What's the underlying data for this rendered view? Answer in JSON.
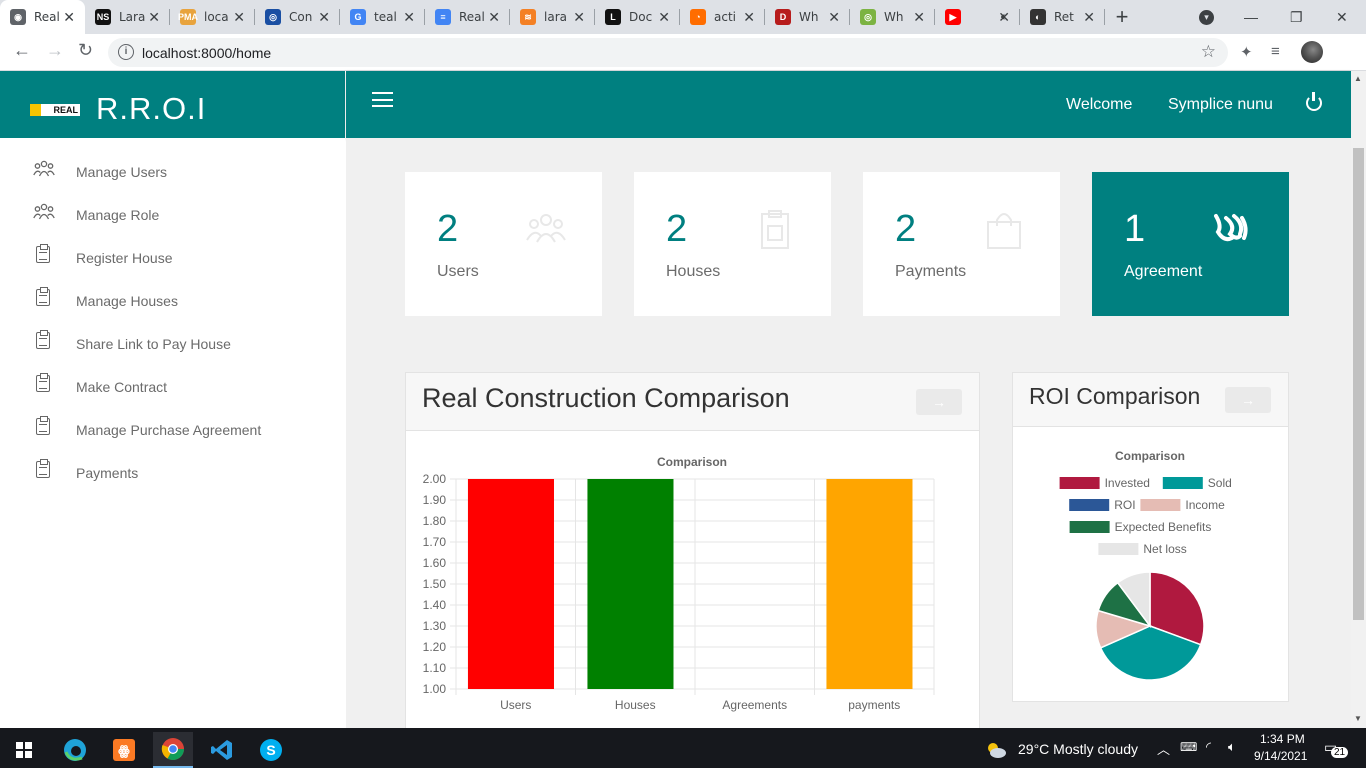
{
  "browser": {
    "tabs": [
      {
        "title": "Real",
        "color": "#5f6368",
        "glyph": "◉",
        "active": true
      },
      {
        "title": "Lara",
        "color": "#111111",
        "glyph": "NS"
      },
      {
        "title": "loca",
        "color": "#e8a33d",
        "glyph": "PMA"
      },
      {
        "title": "Con",
        "color": "#1a4fa3",
        "glyph": "◎"
      },
      {
        "title": "teal",
        "color": "#4285f4",
        "glyph": "G"
      },
      {
        "title": "Real",
        "color": "#4285f4",
        "glyph": "≡"
      },
      {
        "title": "lara",
        "color": "#f48024",
        "glyph": "≋"
      },
      {
        "title": "Doc",
        "color": "#111111",
        "glyph": "L"
      },
      {
        "title": "acti",
        "color": "#ff6d00",
        "glyph": "◔"
      },
      {
        "title": "Wh",
        "color": "#b71c1c",
        "glyph": "D"
      },
      {
        "title": "Wh",
        "color": "#7cb342",
        "glyph": "◎"
      },
      {
        "title": "",
        "color": "#ff0000",
        "glyph": "▶"
      },
      {
        "title": "Ret",
        "color": "#333333",
        "glyph": "◐"
      }
    ],
    "url": "localhost:8000/home"
  },
  "app": {
    "brand": "R.R.O.I",
    "logo_text": "REAL",
    "welcome": "Welcome",
    "user_name": "Symplice nunu",
    "accent": "#008080"
  },
  "sidebar": {
    "items": [
      {
        "label": "Manage Users",
        "icon": "users-icon"
      },
      {
        "label": "Manage Role",
        "icon": "users-icon"
      },
      {
        "label": "Register House",
        "icon": "clipboard-icon"
      },
      {
        "label": "Manage Houses",
        "icon": "clipboard-icon"
      },
      {
        "label": "Share Link to Pay House",
        "icon": "clipboard-icon"
      },
      {
        "label": "Make Contract",
        "icon": "clipboard-icon"
      },
      {
        "label": "Manage Purchase Agreement",
        "icon": "clipboard-icon"
      },
      {
        "label": "Payments",
        "icon": "clipboard-icon"
      }
    ]
  },
  "stats": [
    {
      "value": "2",
      "label": "Users",
      "icon": "users-icon"
    },
    {
      "value": "2",
      "label": "Houses",
      "icon": "clipboard-icon"
    },
    {
      "value": "2",
      "label": "Payments",
      "icon": "shopping-bag-icon"
    },
    {
      "value": "1",
      "label": "Agreement",
      "icon": "handshake-icon"
    }
  ],
  "panels": {
    "construction": {
      "title": "Real Construction Comparison",
      "button": "→"
    },
    "roi": {
      "title": "ROI Comparison",
      "button": "→"
    }
  },
  "chart_data": [
    {
      "type": "bar",
      "title": "Comparison",
      "categories": [
        "Users",
        "Houses",
        "Agreements",
        "payments"
      ],
      "values": [
        2,
        2,
        1,
        2
      ],
      "colors": [
        "#ff0000",
        "#008000",
        "#ffffff",
        "#ffa500"
      ],
      "ylim": [
        1.0,
        2.0
      ],
      "yticks": [
        "2.00",
        "1.90",
        "1.80",
        "1.70",
        "1.60",
        "1.50",
        "1.40",
        "1.30",
        "1.20",
        "1.10",
        "1.00"
      ],
      "grid": true
    },
    {
      "type": "pie",
      "title": "Comparison",
      "labels": [
        "Invested",
        "Sold",
        "ROI",
        "Income",
        "Expected Benefits",
        "Net loss"
      ],
      "colors": [
        "#b0193f",
        "#009999",
        "#2b5797",
        "#e5bcb4",
        "#1e7145",
        "#e6e6e6"
      ],
      "values": [
        30,
        37,
        0,
        11,
        10,
        10
      ],
      "legend": "top"
    }
  ],
  "taskbar": {
    "weather": "29°C  Mostly cloudy",
    "time": "1:34 PM",
    "date": "9/14/2021",
    "notifications": "21"
  }
}
